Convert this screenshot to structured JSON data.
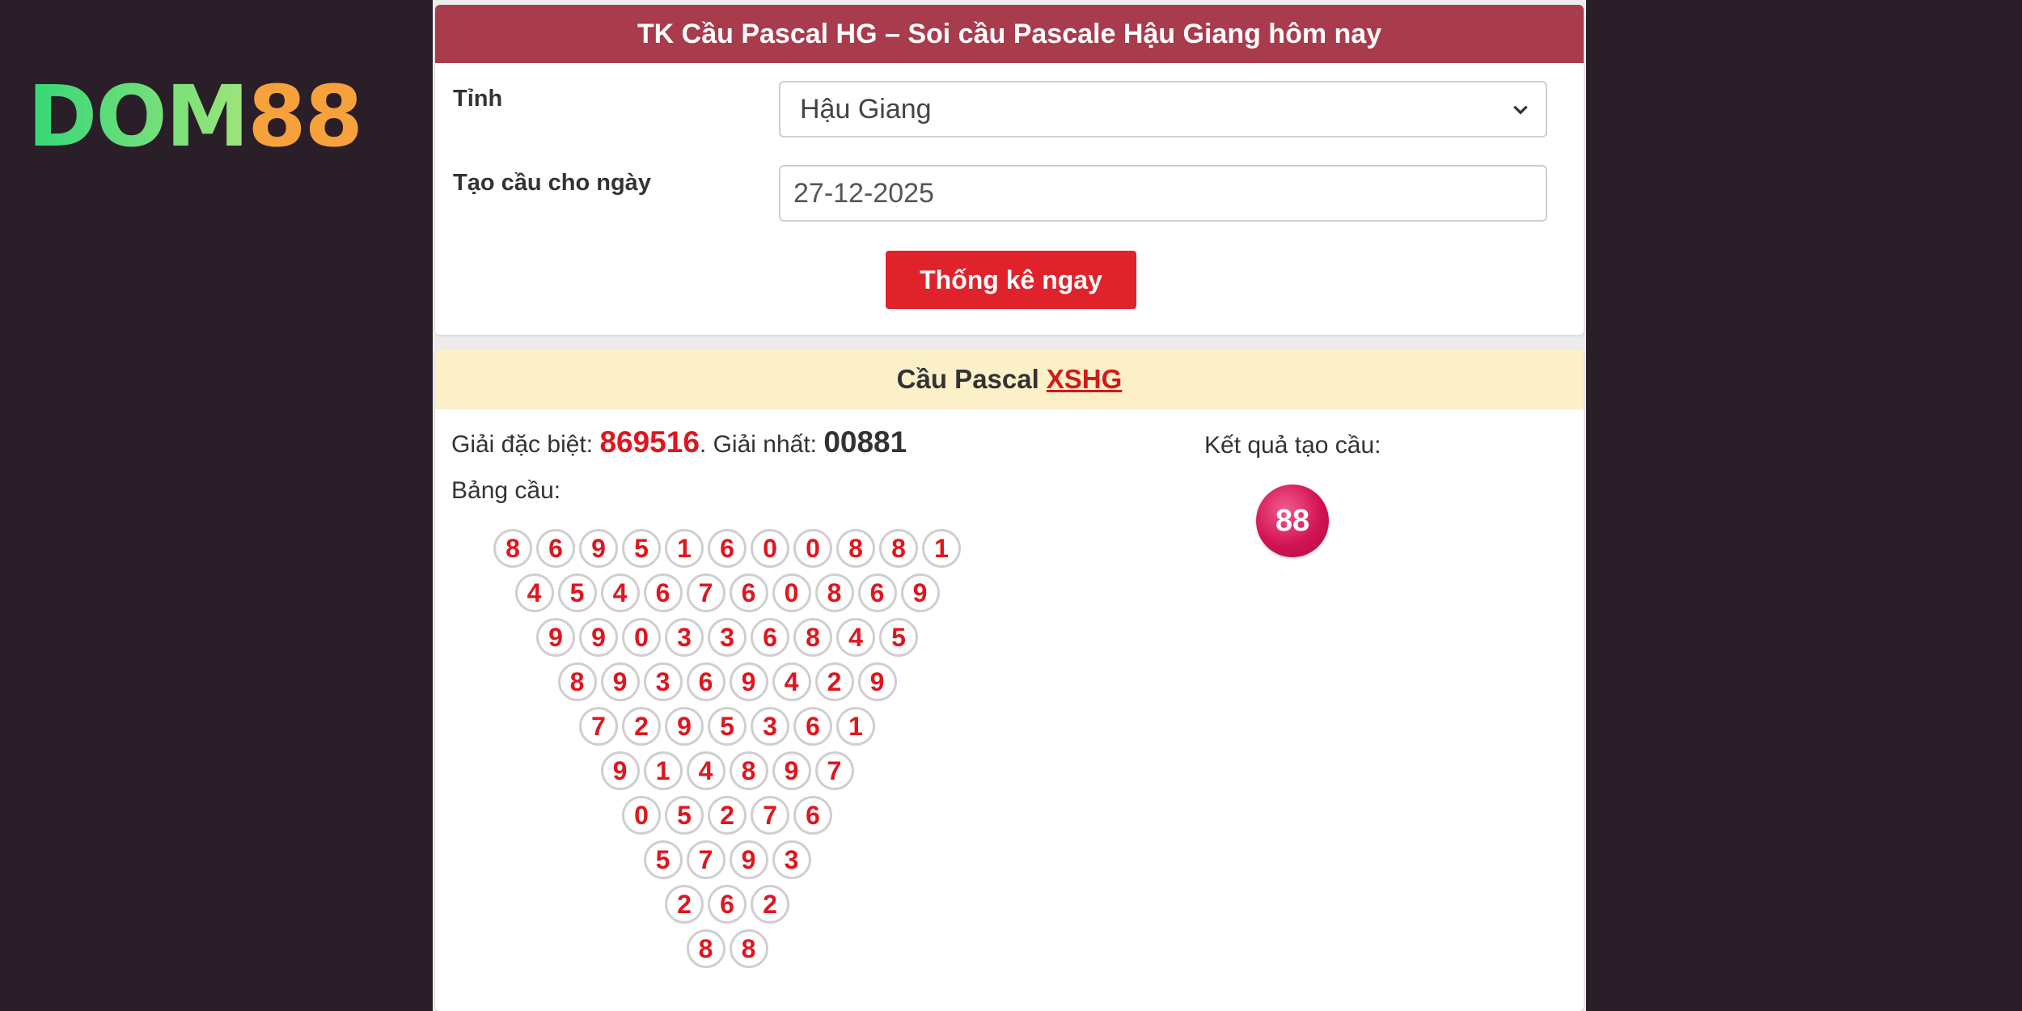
{
  "logo": {
    "part1": "DOM",
    "part2": "88"
  },
  "form": {
    "title": "TK Cầu Pascal HG – Soi cầu Pascale Hậu Giang hôm nay",
    "tinh_label": "Tỉnh",
    "tinh_value": "Hậu Giang",
    "date_label": "Tạo cầu cho ngày",
    "date_value": "27-12-2025",
    "submit_label": "Thống kê ngay"
  },
  "result": {
    "title": "Cầu Pascal",
    "title_link": "XSHG",
    "special_label": "Giải đặc biệt:",
    "special_value": "869516",
    "first_label": ". Giải nhất:",
    "first_value": "00881",
    "table_label": "Bảng cầu:",
    "result_label": "Kết quả tạo cầu:",
    "result_value": "88",
    "triangle": [
      [
        "8",
        "6",
        "9",
        "5",
        "1",
        "6",
        "0",
        "0",
        "8",
        "8",
        "1"
      ],
      [
        "4",
        "5",
        "4",
        "6",
        "7",
        "6",
        "0",
        "8",
        "6",
        "9"
      ],
      [
        "9",
        "9",
        "0",
        "3",
        "3",
        "6",
        "8",
        "4",
        "5"
      ],
      [
        "8",
        "9",
        "3",
        "6",
        "9",
        "4",
        "2",
        "9"
      ],
      [
        "7",
        "2",
        "9",
        "5",
        "3",
        "6",
        "1"
      ],
      [
        "9",
        "1",
        "4",
        "8",
        "9",
        "7"
      ],
      [
        "0",
        "5",
        "2",
        "7",
        "6"
      ],
      [
        "5",
        "7",
        "9",
        "3"
      ],
      [
        "2",
        "6",
        "2"
      ],
      [
        "8",
        "8"
      ]
    ]
  },
  "colors": {
    "header_bg": "#a83b4c",
    "button_bg": "#e0222b",
    "digit_red": "#e0161e",
    "result_pink": "#d21353"
  }
}
